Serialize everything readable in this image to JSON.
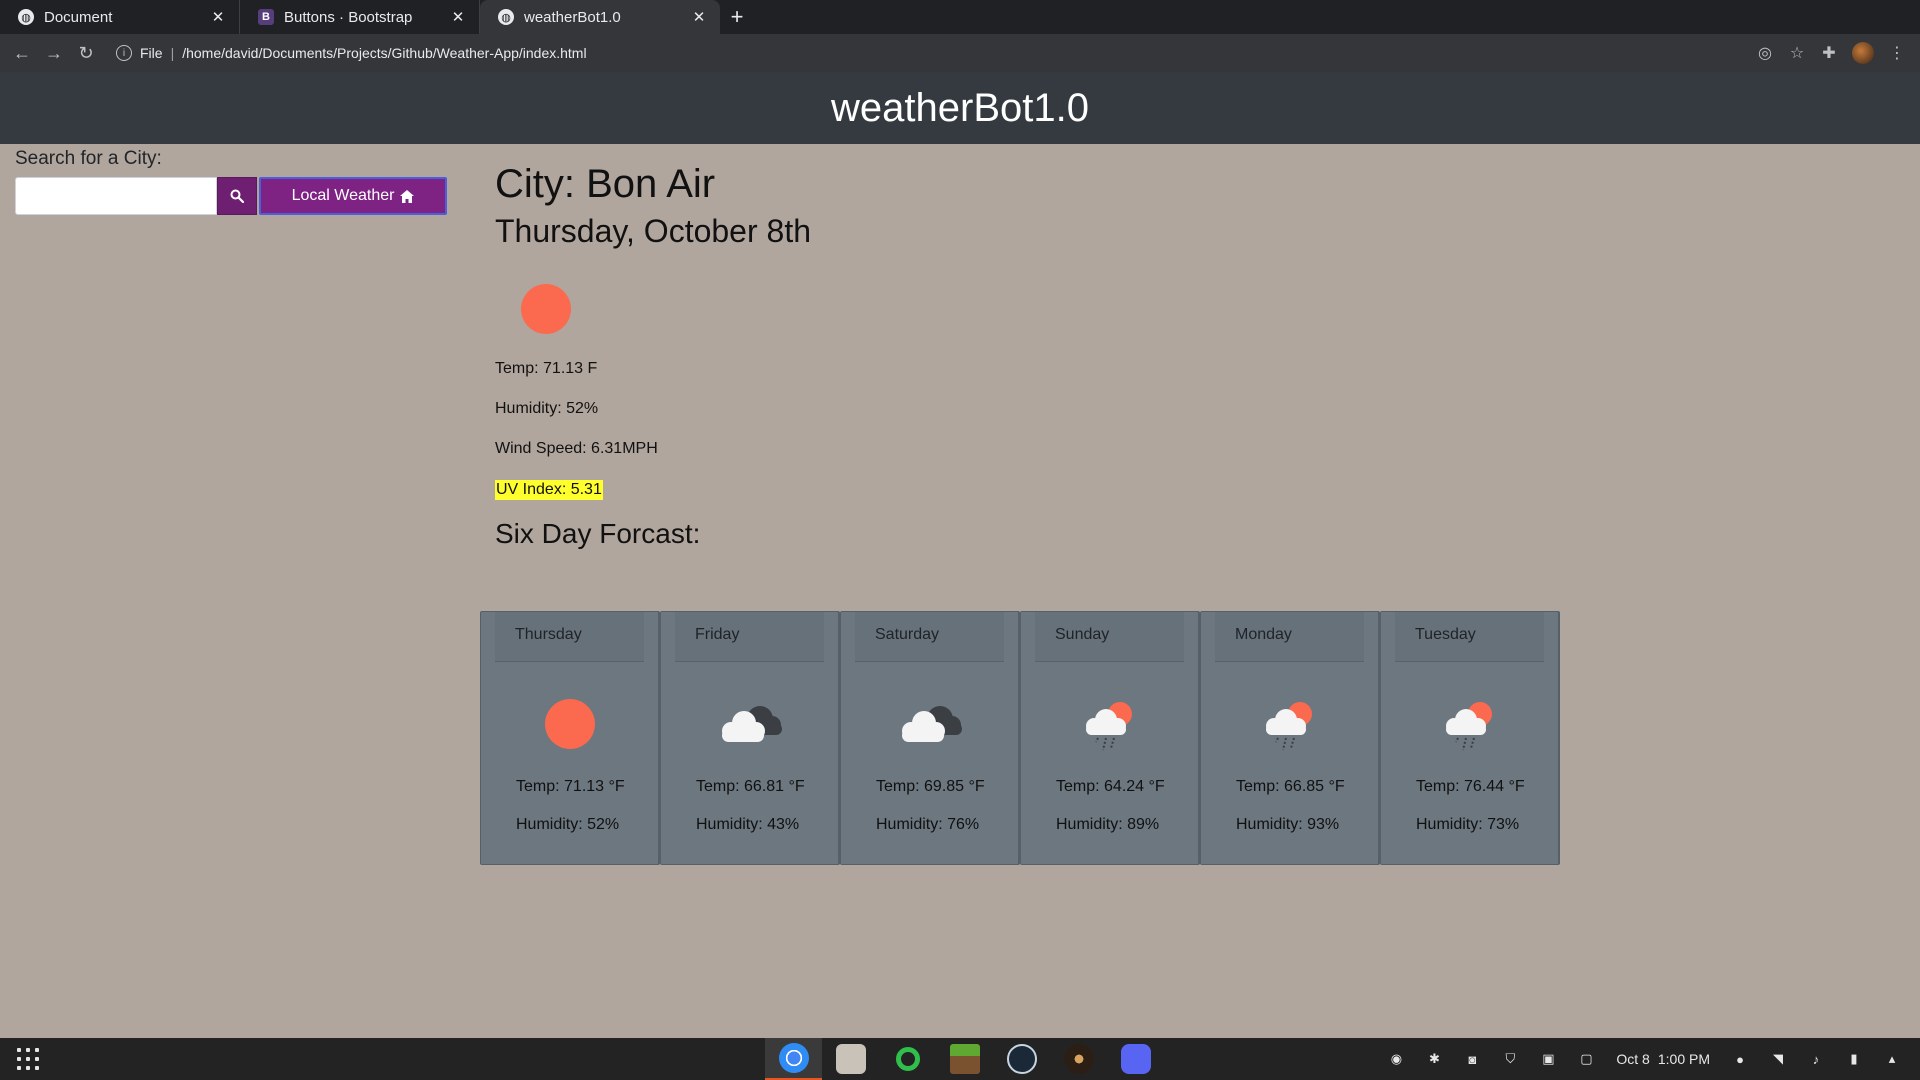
{
  "browser": {
    "tabs": [
      {
        "title": "Document",
        "favicon": "globe-icon"
      },
      {
        "title": "Buttons · Bootstrap",
        "favicon": "bootstrap-icon",
        "favicon_text": "B"
      },
      {
        "title": "weatherBot1.0",
        "favicon": "globe-icon",
        "active": true
      }
    ],
    "scheme_label": "File",
    "address": "/home/david/Documents/Projects/Github/Weather-App/index.html"
  },
  "header": {
    "title": "weatherBot1.0"
  },
  "search": {
    "label": "Search for a City:",
    "value": "",
    "local_button": "Local Weather"
  },
  "current": {
    "city": "City: Bon Air",
    "date": "Thursday, October 8th",
    "icon": "sun",
    "temp": "Temp: 71.13 F",
    "humidity": "Humidity: 52%",
    "wind": "Wind Speed: 6.31MPH",
    "uv": "UV Index: 5.31",
    "uv_color": "#ffff2e"
  },
  "forecast": {
    "title": "Six Day Forcast:",
    "days": [
      {
        "day": "Thursday",
        "icon": "sun",
        "temp": "Temp: 71.13 °F",
        "humidity": "Humidity: 52%"
      },
      {
        "day": "Friday",
        "icon": "clouds",
        "temp": "Temp: 66.81 °F",
        "humidity": "Humidity: 43%"
      },
      {
        "day": "Saturday",
        "icon": "clouds",
        "temp": "Temp: 69.85 °F",
        "humidity": "Humidity: 76%"
      },
      {
        "day": "Sunday",
        "icon": "sun-rain",
        "temp": "Temp: 64.24 °F",
        "humidity": "Humidity: 89%"
      },
      {
        "day": "Monday",
        "icon": "sun-rain",
        "temp": "Temp: 66.85 °F",
        "humidity": "Humidity: 93%"
      },
      {
        "day": "Tuesday",
        "icon": "sun-rain",
        "temp": "Temp: 76.44 °F",
        "humidity": "Humidity: 73%"
      }
    ]
  },
  "colors": {
    "page_bg": "#b1a69e",
    "header_bg": "#343a40",
    "button_purple": "#7e2284",
    "card_bg": "#6c7780",
    "sun": "#fb6a4f"
  },
  "taskbar": {
    "date": "Oct 8",
    "time": "1:00 PM"
  }
}
